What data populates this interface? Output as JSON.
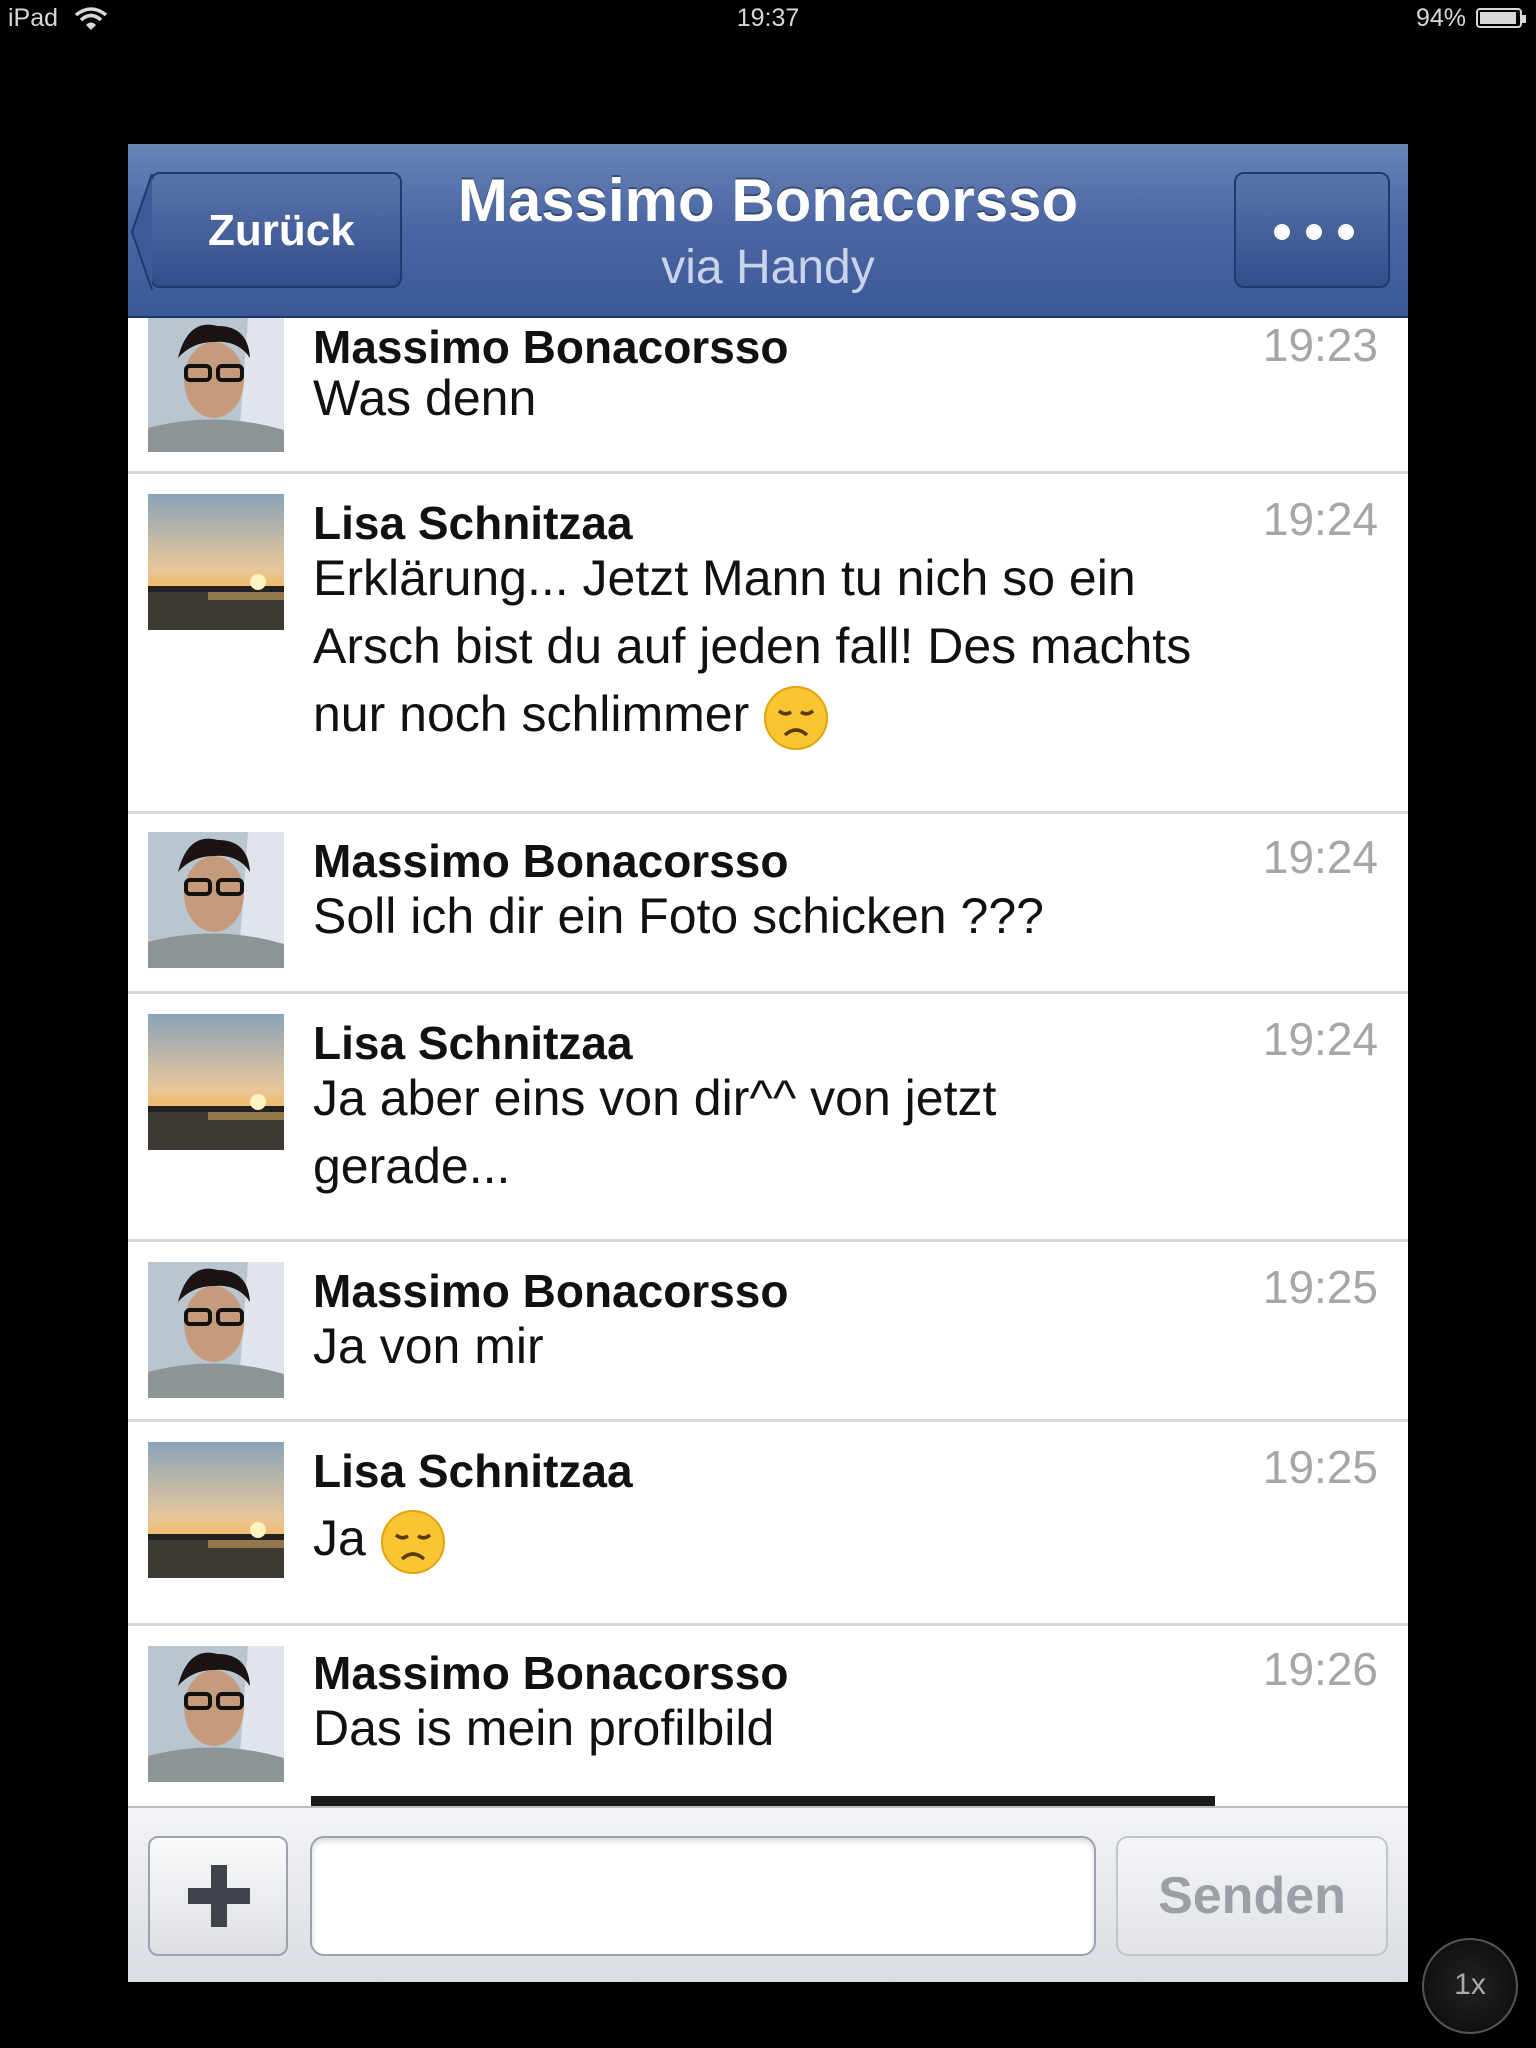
{
  "status_bar": {
    "device": "iPad",
    "time": "19:37",
    "battery": "94%",
    "battery_level": 0.94
  },
  "header": {
    "back_label": "Zurück",
    "title": "Massimo Bonacorsso",
    "subtitle": "via Handy",
    "more_icon": "ellipsis-icon"
  },
  "messages": [
    {
      "sender": "Massimo Bonacorsso",
      "time": "19:23",
      "text": "Was denn",
      "avatar": "boy-glasses"
    },
    {
      "sender": "Lisa Schnitzaa",
      "time": "19:24",
      "text": "Erklärung... Jetzt Mann tu nich so ein Arsch bist du auf jeden fall! Des machts nur noch schlimmer",
      "emoji": "disappointed-face",
      "avatar": "sunset"
    },
    {
      "sender": "Massimo Bonacorsso",
      "time": "19:24",
      "text": "Soll ich dir ein Foto schicken ???",
      "avatar": "boy-glasses"
    },
    {
      "sender": "Lisa Schnitzaa",
      "time": "19:24",
      "text": "Ja aber eins von dir^^ von jetzt gerade...",
      "avatar": "sunset"
    },
    {
      "sender": "Massimo Bonacorsso",
      "time": "19:25",
      "text": "Ja von mir",
      "avatar": "boy-glasses"
    },
    {
      "sender": "Lisa Schnitzaa",
      "time": "19:25",
      "text": "Ja",
      "emoji": "disappointed-face",
      "avatar": "sunset"
    },
    {
      "sender": "Massimo Bonacorsso",
      "time": "19:26",
      "text": "Das is mein profilbild",
      "avatar": "boy-glasses"
    }
  ],
  "composer": {
    "input_value": "",
    "send_label": "Senden",
    "plus_icon": "plus-icon"
  },
  "zoom_label": "1x",
  "colors": {
    "navbar": "#3b5897",
    "separator": "#d8d8d8",
    "timestamp": "#a6a6a6"
  }
}
